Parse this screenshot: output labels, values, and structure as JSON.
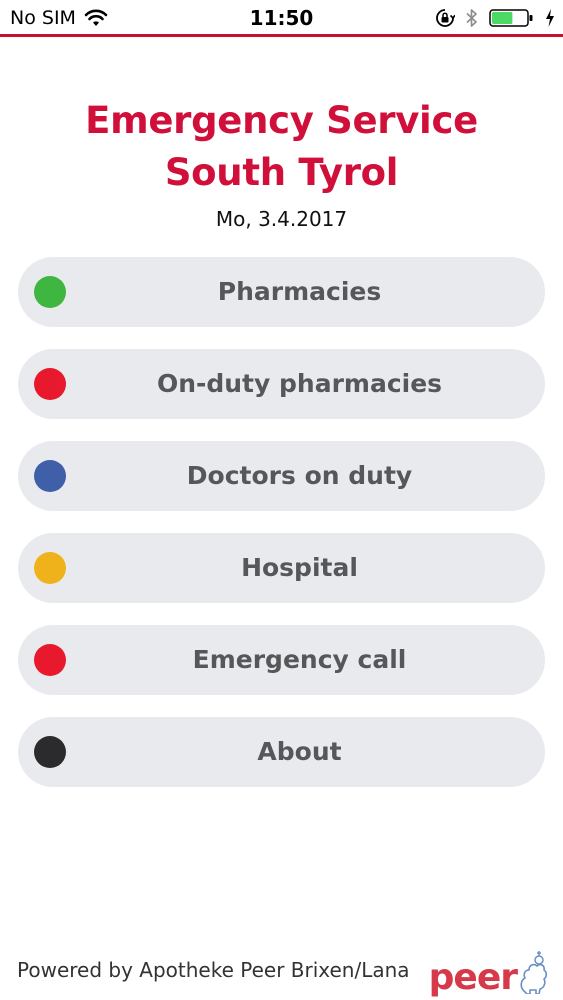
{
  "status_bar": {
    "carrier": "No SIM",
    "time": "11:50",
    "icons": [
      "wifi-icon",
      "rotation-lock-icon",
      "bluetooth-icon",
      "battery-icon",
      "charging-icon"
    ],
    "battery_level": 0.6,
    "battery_color": "#4cd964"
  },
  "header": {
    "title": "Emergency Service South Tyrol",
    "title_color": "#d0103a",
    "date": "Mo, 3.4.2017"
  },
  "menu": {
    "items": [
      {
        "label": "Pharmacies",
        "dot_color": "#3fb63f"
      },
      {
        "label": "On-duty pharmacies",
        "dot_color": "#e8192c"
      },
      {
        "label": "Doctors on duty",
        "dot_color": "#3f5fa8"
      },
      {
        "label": "Hospital",
        "dot_color": "#f0b21a"
      },
      {
        "label": "Emergency call",
        "dot_color": "#e8192c"
      },
      {
        "label": "About",
        "dot_color": "#2b2b2e"
      }
    ]
  },
  "footer": {
    "powered_by": "Powered by Apotheke Peer Brixen/Lana",
    "brand": "peer",
    "brand_color": "#d63a4a",
    "brand_icon": "lamb-icon"
  }
}
